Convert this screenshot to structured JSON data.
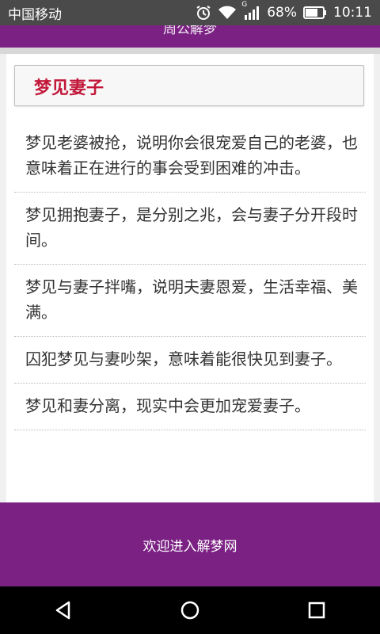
{
  "status_bar": {
    "carrier": "中国移动",
    "battery": "68%",
    "time": "10:11",
    "signal_badge": "G",
    "icons": [
      "alarm-icon",
      "wifi-icon",
      "signal-icon",
      "battery-icon"
    ]
  },
  "header": {
    "title": "周公解梦"
  },
  "article": {
    "title": "梦见妻子",
    "items": [
      "梦见老婆被抢，说明你会很宠爱自己的老婆，也意味着正在进行的事会受到困难的冲击。",
      "梦见拥抱妻子，是分别之兆，会与妻子分开段时间。",
      "梦见与妻子拌嘴，说明夫妻恩爱，生活幸福、美满。",
      "囚犯梦见与妻吵架，意味着能很快见到妻子。",
      "梦见和妻分离，现实中会更加宠爱妻子。"
    ]
  },
  "bottom_banner": {
    "text": "欢迎进入解梦网"
  },
  "navbar": {
    "icons": [
      "back-icon",
      "home-icon",
      "recents-icon"
    ]
  },
  "colors": {
    "header": "#7b2183",
    "title": "#c2183a",
    "statusbar": "#4a4a4a"
  }
}
